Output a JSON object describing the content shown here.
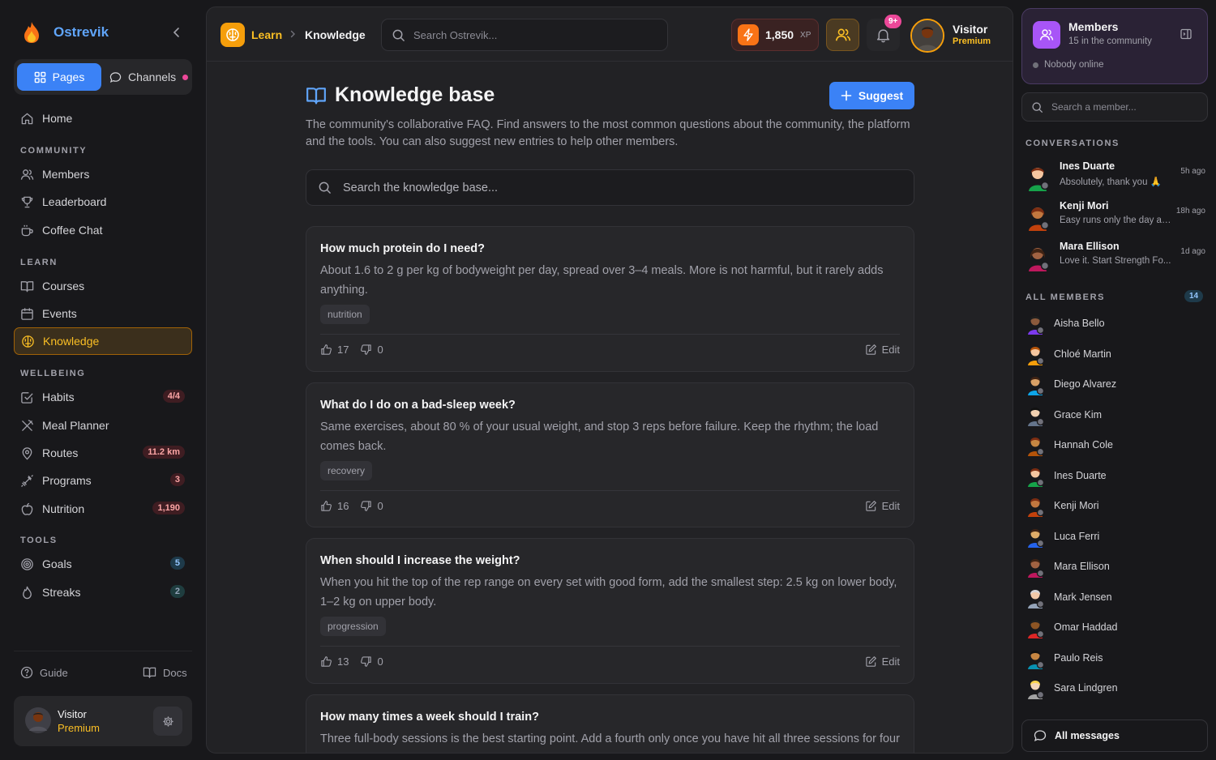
{
  "app": {
    "name": "Ostrevik"
  },
  "sidebar": {
    "segments": {
      "pages": "Pages",
      "channels": "Channels"
    },
    "home": "Home",
    "sections": {
      "community": "COMMUNITY",
      "learn": "LEARN",
      "wellbeing": "WELLBEING",
      "tools": "TOOLS"
    },
    "community": [
      "Members",
      "Leaderboard",
      "Coffee Chat"
    ],
    "learn": [
      "Courses",
      "Events",
      "Knowledge"
    ],
    "wellbeing": [
      {
        "label": "Habits",
        "badge": "4/4"
      },
      {
        "label": "Meal Planner",
        "badge": ""
      },
      {
        "label": "Routes",
        "badge": "11.2 km"
      },
      {
        "label": "Programs",
        "badge": "3"
      },
      {
        "label": "Nutrition",
        "badge": "1,190"
      }
    ],
    "tools": [
      {
        "label": "Goals",
        "badge": "5"
      },
      {
        "label": "Streaks",
        "badge": "2"
      }
    ],
    "footer": {
      "guide": "Guide",
      "docs": "Docs"
    },
    "user": {
      "name": "Visitor",
      "plan": "Premium"
    }
  },
  "topbar": {
    "breadcrumb": {
      "section": "Learn",
      "current": "Knowledge"
    },
    "search_placeholder": "Search Ostrevik...",
    "xp_value": "1,850",
    "xp_unit": "XP",
    "notifications_badge": "9+",
    "user": {
      "name": "Visitor",
      "plan": "Premium"
    }
  },
  "page": {
    "title": "Knowledge base",
    "suggest_label": "Suggest",
    "description": "The community's collaborative FAQ. Find answers to the most common questions about the community, the platform and the tools. You can also suggest new entries to help other members.",
    "search_placeholder": "Search the knowledge base...",
    "edit_label": "Edit",
    "entries": [
      {
        "question": "How much protein do I need?",
        "answer": "About 1.6 to 2 g per kg of bodyweight per day, spread over 3–4 meals. More is not harmful, but it rarely adds anything.",
        "tag": "nutrition",
        "up": "17",
        "down": "0"
      },
      {
        "question": "What do I do on a bad-sleep week?",
        "answer": "Same exercises, about 80 % of your usual weight, and stop 3 reps before failure. Keep the rhythm; the load comes back.",
        "tag": "recovery",
        "up": "16",
        "down": "0"
      },
      {
        "question": "When should I increase the weight?",
        "answer": "When you hit the top of the rep range on every set with good form, add the smallest step: 2.5 kg on lower body, 1–2 kg on upper body.",
        "tag": "progression",
        "up": "13",
        "down": "0"
      },
      {
        "question": "How many times a week should I train?",
        "answer": "Three full-body sessions is the best starting point. Add a fourth only once you have hit all three sessions for four",
        "tag": "",
        "up": "",
        "down": ""
      }
    ]
  },
  "members_panel": {
    "title": "Members",
    "subtitle": "15 in the community",
    "online_status": "Nobody online",
    "search_placeholder": "Search a member...",
    "conversations_label": "CONVERSATIONS",
    "conversations": [
      {
        "name": "Ines Duarte",
        "message": "Absolutely, thank you 🙏",
        "time": "5h ago"
      },
      {
        "name": "Kenji Mori",
        "message": "Easy runs only the day after",
        "time": "18h ago"
      },
      {
        "name": "Mara Ellison",
        "message": "Love it. Start Strength Fo...",
        "time": "1d ago"
      }
    ],
    "all_members_label": "ALL MEMBERS",
    "all_members_count": "14",
    "members": [
      "Aisha Bello",
      "Chloé Martin",
      "Diego Alvarez",
      "Grace Kim",
      "Hannah Cole",
      "Ines Duarte",
      "Kenji Mori",
      "Luca Ferri",
      "Mara Ellison",
      "Mark Jensen",
      "Omar Haddad",
      "Paulo Reis",
      "Sara Lindgren"
    ],
    "all_messages_label": "All messages"
  }
}
